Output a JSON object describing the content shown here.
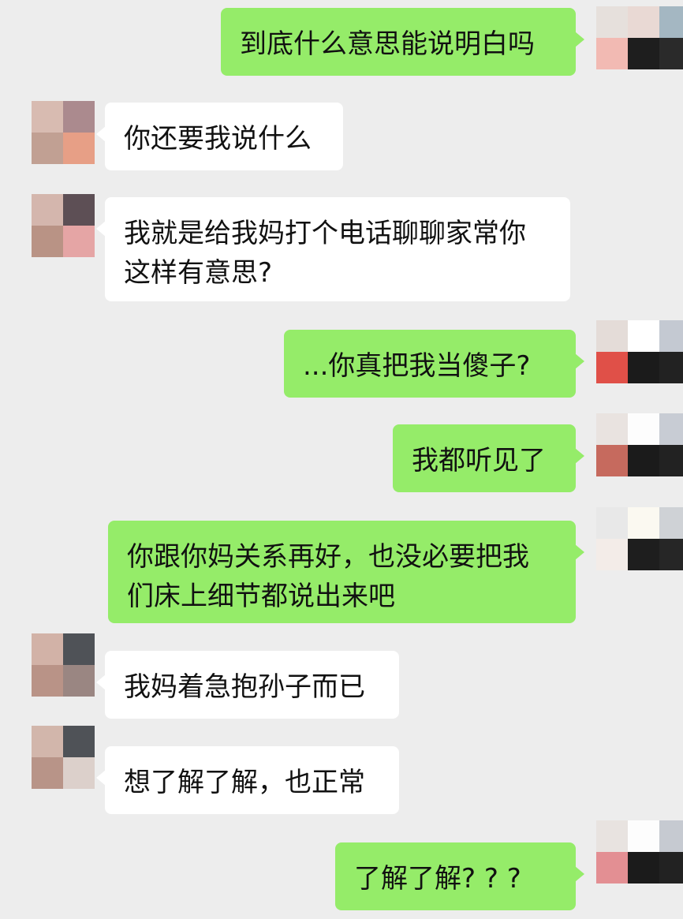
{
  "messages": [
    {
      "side": "right",
      "text": "到底什么意思能说明白吗"
    },
    {
      "side": "left",
      "text": "你还要我说什么"
    },
    {
      "side": "left",
      "text": "我就是给我妈打个电话聊聊家常你\n这样有意思?"
    },
    {
      "side": "right",
      "text": "...你真把我当傻子?"
    },
    {
      "side": "right",
      "text": "我都听见了"
    },
    {
      "side": "right",
      "text": "你跟你妈关系再好，也没必要把我\n们床上细节都说出来吧"
    },
    {
      "side": "left",
      "text": "我妈着急抱孙子而已"
    },
    {
      "side": "left",
      "text": "想了解了解，也正常"
    },
    {
      "side": "right",
      "text": "了解了解? ? ?"
    }
  ],
  "colors": {
    "background": "#ededed",
    "sent_bubble": "#95ec69",
    "received_bubble": "#ffffff"
  },
  "avatars": {
    "left": [
      [
        "#d8bbb1",
        "#ab8a8e",
        "#c1a093",
        "#e79f86"
      ],
      [
        "#d4b6ad",
        "#5d4f55",
        "#b99385",
        "#e5a5a5"
      ],
      [
        "#d2b2a7",
        "#4f5257",
        "#b99387",
        "#9a8682"
      ],
      [
        "#d2b6ab",
        "#4f5257",
        "#b89488",
        "#dcd0cb"
      ]
    ],
    "right": [
      [
        "#e6e0dc",
        "#e9d9d4",
        "#a4b7c2",
        "#f2bab3",
        "#1e1e1e",
        "#2a2a2a"
      ],
      [
        "#e4dcd8",
        "#ffffff",
        "#c4c9d2",
        "#e05048",
        "#1b1b1b",
        "#222222"
      ],
      [
        "#e9e3e0",
        "#fdfdfd",
        "#c8ccd4",
        "#c66a5e",
        "#1b1b1b",
        "#222222"
      ],
      [
        "#e8e8e8",
        "#fbf9f1",
        "#cfd2d6",
        "#f3ece8",
        "#1e1e1e",
        "#262626"
      ],
      [
        "#e8e3e0",
        "#fdfdfd",
        "#c6cad1",
        "#e38f93",
        "#1b1b1b",
        "#222222"
      ]
    ]
  }
}
